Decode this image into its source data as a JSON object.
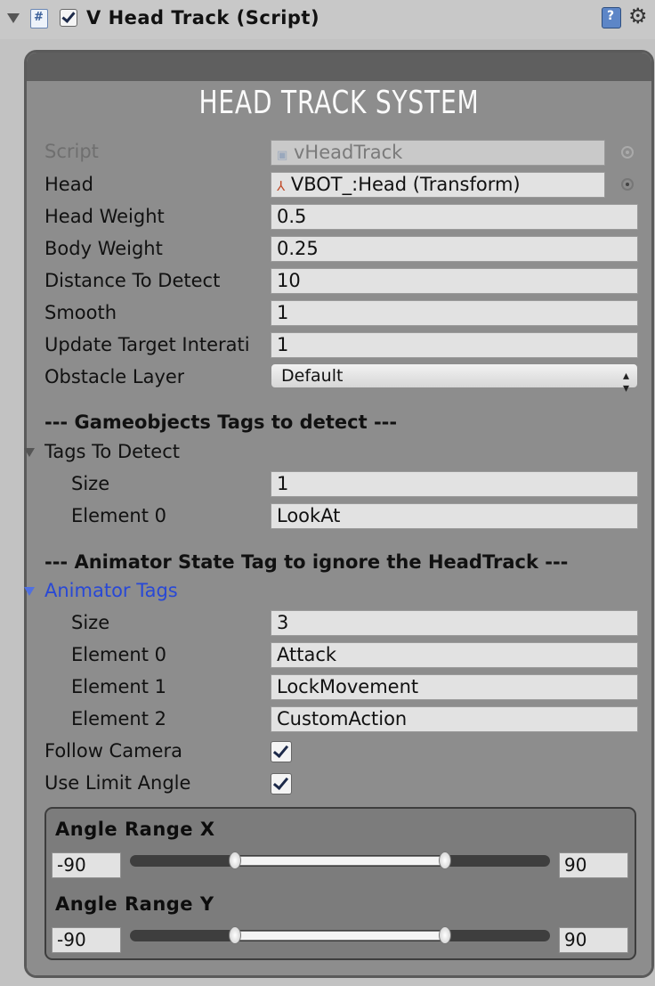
{
  "header": {
    "title": "V Head Track (Script)",
    "enabled": true
  },
  "panel": {
    "title": "HEAD TRACK SYSTEM"
  },
  "fields": {
    "script": {
      "label": "Script",
      "value": "vHeadTrack"
    },
    "head": {
      "label": "Head",
      "value": "VBOT_:Head (Transform)"
    },
    "head_weight": {
      "label": "Head Weight",
      "value": "0.5"
    },
    "body_weight": {
      "label": "Body Weight",
      "value": "0.25"
    },
    "distance_to_detect": {
      "label": "Distance To Detect",
      "value": "10"
    },
    "smooth": {
      "label": "Smooth",
      "value": "1"
    },
    "update_target": {
      "label": "Update Target Interati",
      "value": "1"
    },
    "obstacle_layer": {
      "label": "Obstacle Layer",
      "value": "Default"
    }
  },
  "tags_section": {
    "heading": "--- Gameobjects Tags to detect ---",
    "foldout": "Tags To Detect",
    "size_label": "Size",
    "size": "1",
    "elements": [
      {
        "label": "Element 0",
        "value": "LookAt"
      }
    ]
  },
  "animator_section": {
    "heading": "--- Animator State Tag to ignore the HeadTrack ---",
    "foldout": "Animator Tags",
    "size_label": "Size",
    "size": "3",
    "elements": [
      {
        "label": "Element 0",
        "value": "Attack"
      },
      {
        "label": "Element 1",
        "value": "LockMovement"
      },
      {
        "label": "Element 2",
        "value": "CustomAction"
      }
    ]
  },
  "toggles": {
    "follow_camera": {
      "label": "Follow Camera",
      "checked": true
    },
    "use_limit_angle": {
      "label": "Use Limit Angle",
      "checked": true
    }
  },
  "angle_range_x": {
    "label": "Angle Range X",
    "min": "-90",
    "max": "90",
    "low_fraction": 0.25,
    "high_fraction": 0.75
  },
  "angle_range_y": {
    "label": "Angle Range Y",
    "min": "-90",
    "max": "90",
    "low_fraction": 0.25,
    "high_fraction": 0.75
  },
  "colors": {
    "panel_background": "#8d8d8d",
    "panel_border": "#5a5a5a",
    "foldout_active": "#2848d6"
  },
  "icons": [
    "foldout-arrow-icon",
    "script-icon",
    "enabled-checkbox",
    "help-icon",
    "gear-icon",
    "transform-icon",
    "object-picker-icon"
  ]
}
